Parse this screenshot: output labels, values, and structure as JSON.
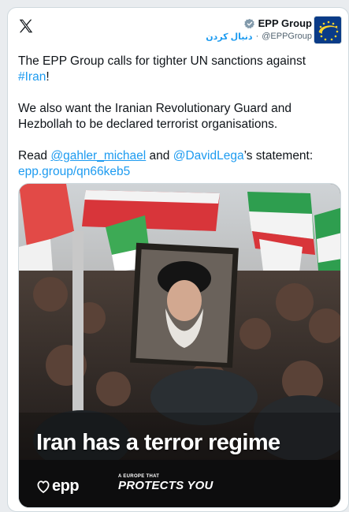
{
  "header": {
    "author_name": "EPP Group",
    "follow_label": "دنبال کردن",
    "dot": "·",
    "handle": "@EPPGroup",
    "icons": {
      "platform": "x-logo-icon",
      "verified": "verified-badge-icon"
    }
  },
  "tweet": {
    "p1_text": "The EPP Group calls for tighter UN sanctions against ",
    "p1_hashtag": "#Iran",
    "p1_end": "!",
    "p2": "We also want the Iranian Revolutionary Guard and Hezbollah to be declared terrorist organisations.",
    "p3_read": "Read ",
    "p3_mention1": "@gahler_michael",
    "p3_and": " and ",
    "p3_mention2": "@DavidLega",
    "p3_statement": "’s statement:",
    "p3_url": "epp.group/qn66keb5"
  },
  "media": {
    "headline": "Iran has a terror regime",
    "logo_text": "epp",
    "slogan_small": "A EUROPE THAT",
    "slogan_big": "PROTECTS YOU"
  },
  "colors": {
    "link": "#1d9bf0",
    "text": "#0f1419",
    "muted": "#536471",
    "border": "#cfd9de",
    "epp_blue": "#0a3b87",
    "flag_green": "#2e9e4f",
    "flag_red": "#d8353a"
  }
}
